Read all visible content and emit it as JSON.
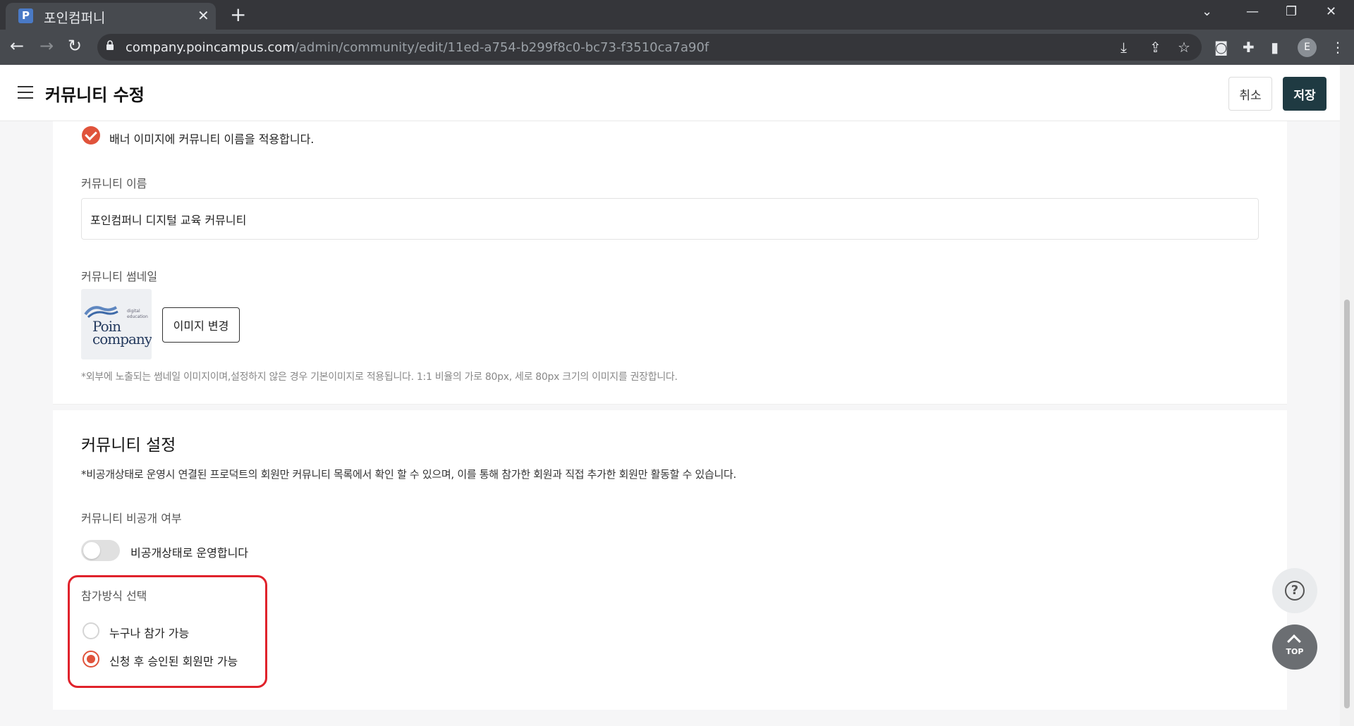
{
  "browser": {
    "tab_title": "포인컴퍼니",
    "tab_favicon_letter": "P",
    "url_host": "company.poincampus.com",
    "url_path": "/admin/community/edit/11ed-a754-b299f8c0-bc73-f3510ca7a90f",
    "profile_initial": "E"
  },
  "header": {
    "title": "커뮤니티 수정",
    "cancel_label": "취소",
    "save_label": "저장"
  },
  "basic": {
    "banner_check_label": "배너 이미지에 커뮤니티 이름을 적용합니다.",
    "name_label": "커뮤니티 이름",
    "name_value": "포인컴퍼니 디지털 교육 커뮤니티",
    "thumbnail_label": "커뮤니티 썸네일",
    "thumbnail_logo_text": "Poin company",
    "thumbnail_logo_small": "digital education",
    "change_image_label": "이미지 변경",
    "thumbnail_hint": "*외부에 노출되는 썸네일 이미지이며,설정하지 않은 경우 기본이미지로 적용됩니다. 1:1 비율의 가로 80px, 세로 80px 크기의 이미지를 권장합니다."
  },
  "settings": {
    "title": "커뮤니티 설정",
    "description": "*비공개상태로 운영시 연결된 프로덕트의 회원만 커뮤니티 목록에서 확인 할 수 있으며, 이를 통해 참가한 회원과 직접 추가한 회원만 활동할 수 있습니다.",
    "private_label": "커뮤니티 비공개 여부",
    "private_toggle_label": "비공개상태로 운영합니다",
    "private_enabled": false,
    "join_method_label": "참가방식 선택",
    "join_options": [
      {
        "label": "누구나 참가 가능",
        "selected": false
      },
      {
        "label": "신청 후 승인된 회원만 가능",
        "selected": true
      }
    ]
  },
  "floating": {
    "help_icon": "question-icon",
    "top_label": "TOP"
  },
  "colors": {
    "accent": "#e0533b",
    "save_button": "#1f3a42",
    "highlight": "#e0222b"
  }
}
